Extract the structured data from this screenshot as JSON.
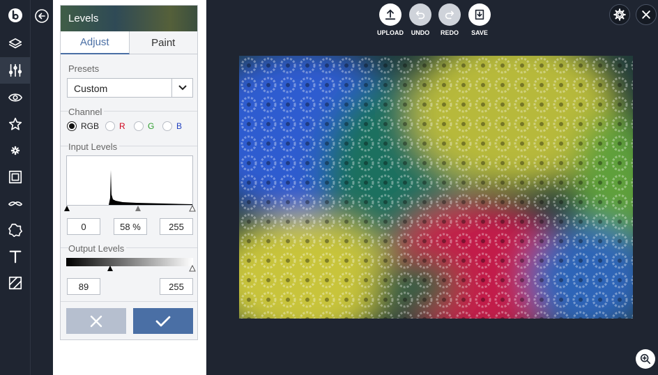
{
  "panel": {
    "title": "Levels",
    "tabs": [
      "Adjust",
      "Paint"
    ],
    "presets_label": "Presets",
    "preset_value": "Custom",
    "channel_label": "Channel",
    "channels": [
      {
        "label": "RGB",
        "color": "#222222",
        "checked": true
      },
      {
        "label": "R",
        "color": "#d0021b",
        "checked": false
      },
      {
        "label": "G",
        "color": "#2e9e2e",
        "checked": false
      },
      {
        "label": "B",
        "color": "#1f3fbf",
        "checked": false
      }
    ],
    "input_levels_label": "Input Levels",
    "input_black": "0",
    "input_mid": "58 %",
    "input_white": "255",
    "output_levels_label": "Output Levels",
    "output_black": "89",
    "output_white": "255"
  },
  "toolbar": {
    "upload": "UPLOAD",
    "undo": "UNDO",
    "redo": "REDO",
    "save": "SAVE"
  },
  "colors": {
    "accent": "#4a6fa5",
    "cancel": "#b6bfcf",
    "background": "#1f2531"
  },
  "icons": [
    "logo-icon",
    "layers-icon",
    "adjust-icon",
    "eye-icon",
    "star-icon",
    "flower-icon",
    "frame-icon",
    "mustache-icon",
    "shape-icon",
    "text-icon",
    "texture-icon",
    "back-icon",
    "upload-icon",
    "undo-icon",
    "redo-icon",
    "save-icon",
    "gear-icon",
    "close-icon",
    "zoom-in-icon"
  ]
}
